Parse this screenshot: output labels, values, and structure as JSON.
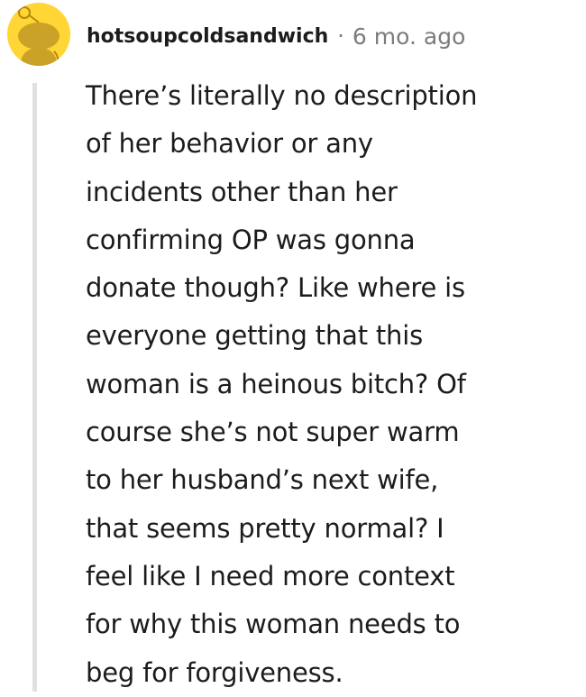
{
  "comment": {
    "author": "hotsoupcoldsandwich",
    "separator": "·",
    "timestamp": "6 mo. ago",
    "avatar_icon": "snoo-avatar-icon",
    "colors": {
      "avatar_background": "#ffd635",
      "text": "#1c1c1c",
      "meta": "#7c7c7c",
      "thread_line": "#e0e0e0"
    },
    "body_lines": [
      "There’s literally no description",
      "of her behavior or any",
      "incidents other than her",
      "confirming OP was gonna",
      "donate though? Like where is",
      "everyone getting that this",
      "woman is a heinous bitch? Of",
      "course she’s not super warm",
      "to her husband’s next wife,",
      "that seems pretty normal? I",
      "feel like I need more context",
      "for why this woman needs to",
      "beg for forgiveness."
    ]
  }
}
